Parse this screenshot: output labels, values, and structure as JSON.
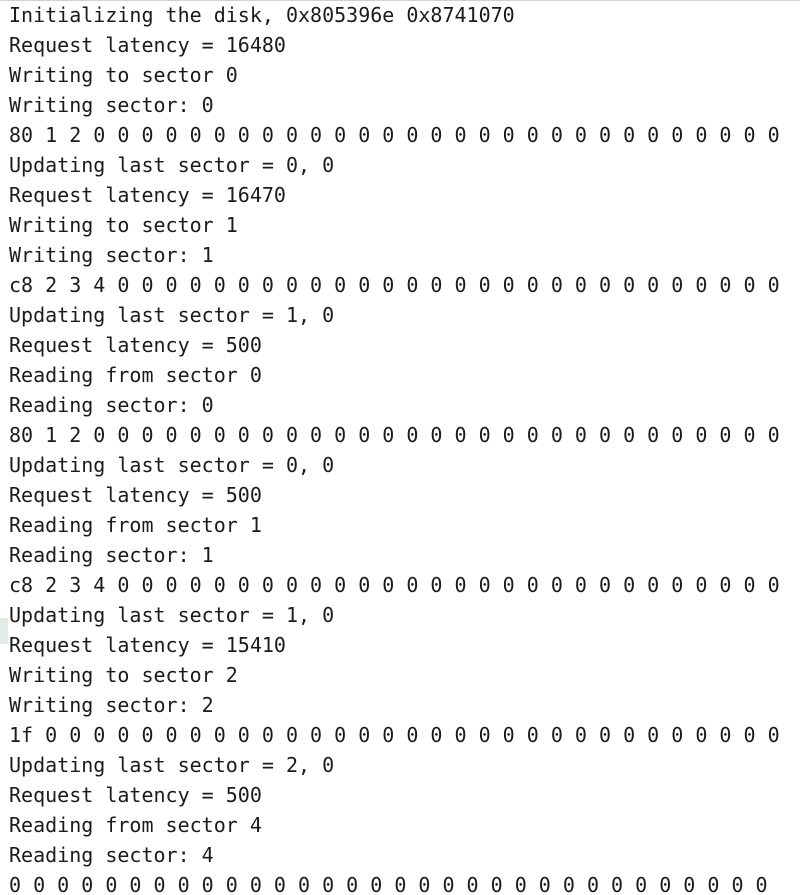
{
  "console": {
    "lines": [
      "Initializing the disk, 0x805396e 0x8741070",
      "Request latency = 16480",
      "Writing to sector 0",
      "Writing sector: 0",
      "80 1 2 0 0 0 0 0 0 0 0 0 0 0 0 0 0 0 0 0 0 0 0 0 0 0 0 0 0 0 0 0",
      "Updating last sector = 0, 0",
      "Request latency = 16470",
      "Writing to sector 1",
      "Writing sector: 1",
      "c8 2 3 4 0 0 0 0 0 0 0 0 0 0 0 0 0 0 0 0 0 0 0 0 0 0 0 0 0 0 0 0",
      "Updating last sector = 1, 0",
      "Request latency = 500",
      "Reading from sector 0",
      "Reading sector: 0",
      "80 1 2 0 0 0 0 0 0 0 0 0 0 0 0 0 0 0 0 0 0 0 0 0 0 0 0 0 0 0 0 0",
      "Updating last sector = 0, 0",
      "Request latency = 500",
      "Reading from sector 1",
      "Reading sector: 1",
      "c8 2 3 4 0 0 0 0 0 0 0 0 0 0 0 0 0 0 0 0 0 0 0 0 0 0 0 0 0 0 0 0",
      "Updating last sector = 1, 0",
      "Request latency = 15410",
      "Writing to sector 2",
      "Writing sector: 2",
      "1f 0 0 0 0 0 0 0 0 0 0 0 0 0 0 0 0 0 0 0 0 0 0 0 0 0 0 0 0 0 0 0",
      "Updating last sector = 2, 0",
      "Request latency = 500",
      "Reading from sector 4",
      "Reading sector: 4",
      "0 0 0 0 0 0 0 0 0 0 0 0 0 0 0 0 0 0 0 0 0 0 0 0 0 0 0 0 0 0 0 0"
    ]
  }
}
